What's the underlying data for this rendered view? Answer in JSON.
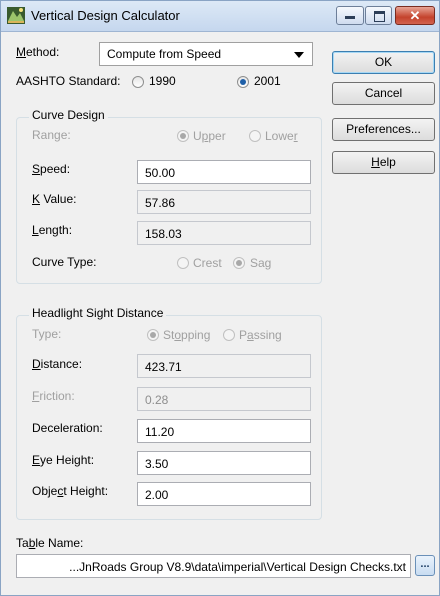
{
  "window": {
    "title": "Vertical Design Calculator",
    "close_glyph": "✕"
  },
  "method": {
    "label_prefix": "",
    "label_accel": "M",
    "label_rest": "ethod:",
    "value": "Compute from Speed"
  },
  "aashto": {
    "label": "AASHTO Standard:",
    "options": [
      {
        "label": "1990",
        "checked": false
      },
      {
        "label": "2001",
        "checked": true
      }
    ]
  },
  "buttons": {
    "ok": "OK",
    "cancel": "Cancel",
    "preferences": "Preferences...",
    "help_accel": "H",
    "help_rest": "elp"
  },
  "curve_design": {
    "title": "Curve Design",
    "range_label": "Range:",
    "range_upper_pre": "U",
    "range_upper_accel": "p",
    "range_upper_post": "per",
    "range_lower_pre": "Lowe",
    "range_lower_accel": "r",
    "range_lower_post": "",
    "range_selected": "Upper",
    "speed_label_accel": "S",
    "speed_label_rest": "peed:",
    "speed_value": "50.00",
    "k_label_accel": "K",
    "k_label_rest": " Value:",
    "k_value": "57.86",
    "length_label_accel": "L",
    "length_label_rest": "ength:",
    "length_value": "158.03",
    "curve_type_label": "Curve Type:",
    "crest": "Crest",
    "sag": "Sag",
    "curve_type_selected": "Sag"
  },
  "headlight": {
    "title": "Headlight Sight Distance",
    "type_label": "Type:",
    "stopping_pre": "St",
    "stopping_accel": "o",
    "stopping_post": "pping",
    "passing_pre": "P",
    "passing_accel": "a",
    "passing_post": "ssing",
    "type_selected": "Stopping",
    "distance_label_accel": "D",
    "distance_label_rest": "istance:",
    "distance_value": "423.71",
    "friction_label_accel": "F",
    "friction_label_rest": "riction:",
    "friction_value": "0.28",
    "deceleration_label": "Deceleration:",
    "deceleration_value": "11.20",
    "eye_height_label_accel": "E",
    "eye_height_label_rest": "ye Height:",
    "eye_height_value": "3.50",
    "object_height_label_pre": "Obje",
    "object_height_label_accel": "c",
    "object_height_label_rest": "t Height:",
    "object_height_value": "2.00"
  },
  "table_name": {
    "label_pre": "Ta",
    "label_accel": "b",
    "label_rest": "le Name:",
    "value": "...JnRoads Group V8.9\\data\\imperial\\Vertical Design Checks.txt",
    "browse_icon": "..."
  },
  "colors": {
    "title_gradient_top": "#dde9f6",
    "close_red": "#c4432c",
    "radio_dot": "#1e5fa8"
  }
}
